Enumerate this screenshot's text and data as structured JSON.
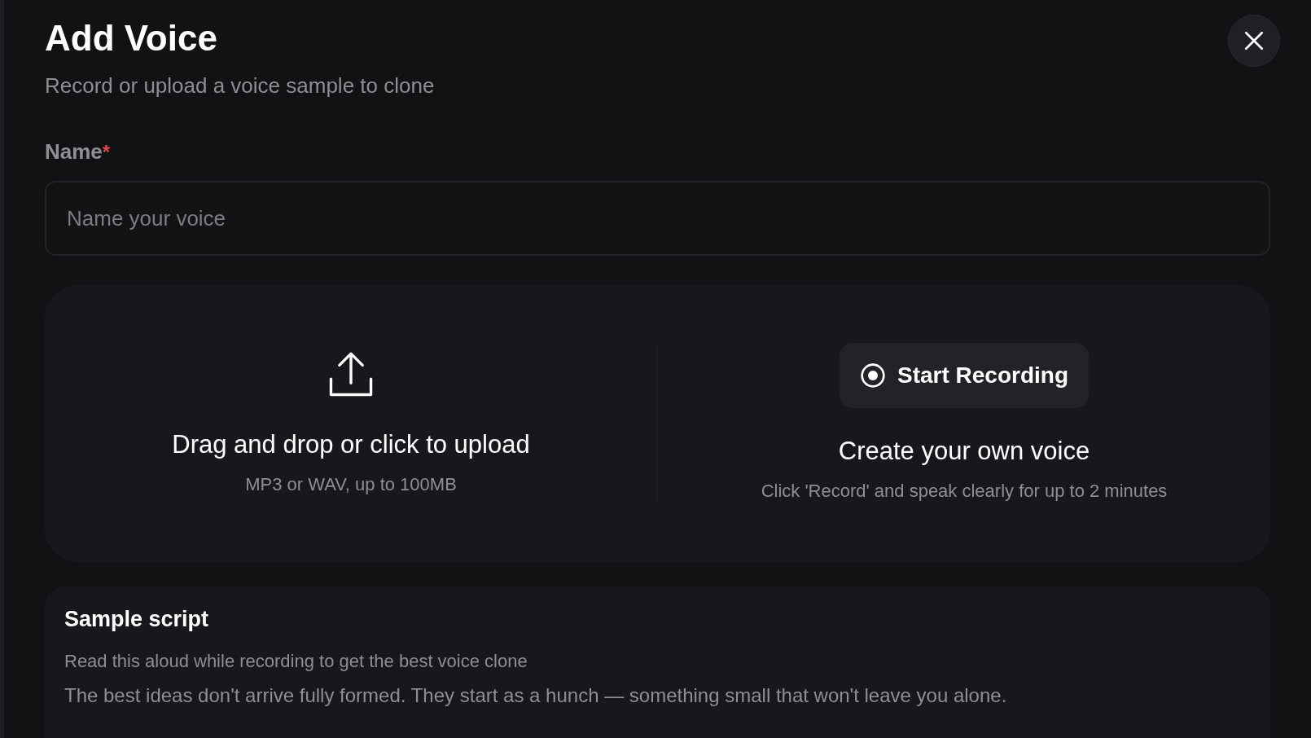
{
  "dialog": {
    "title": "Add Voice",
    "subtitle": "Record or upload a voice sample to clone"
  },
  "name_field": {
    "label": "Name",
    "required_mark": "*",
    "placeholder": "Name your voice"
  },
  "upload": {
    "title": "Drag and drop or click to upload",
    "hint": "MP3 or WAV, up to 100MB"
  },
  "record": {
    "button": "Start Recording",
    "title": "Create your own voice",
    "hint": "Click 'Record' and speak clearly for up to 2 minutes"
  },
  "sample_script": {
    "title": "Sample script",
    "hint": "Read this aloud while recording to get the best voice clone",
    "text": "The best ideas don't arrive fully formed. They start as a hunch — something small that won't leave you alone."
  }
}
